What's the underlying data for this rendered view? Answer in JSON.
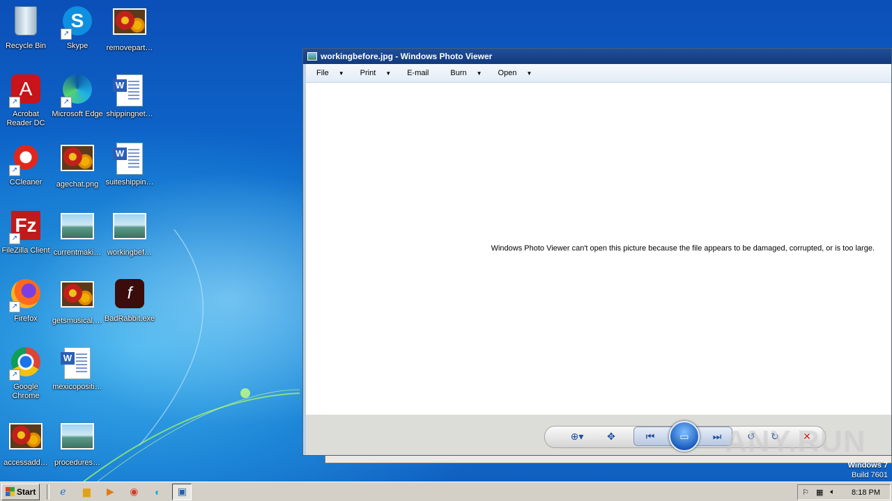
{
  "desktop": {
    "icons": [
      {
        "label": "Recycle Bin",
        "icon": "recycle-bin-icon",
        "shortcut": false
      },
      {
        "label": "Skype",
        "icon": "skype-icon",
        "shortcut": true
      },
      {
        "label": "removepart…",
        "icon": "image-file-icon",
        "shortcut": false
      },
      {
        "label": "Acrobat Reader DC",
        "icon": "acrobat-icon",
        "shortcut": true
      },
      {
        "label": "Microsoft Edge",
        "icon": "edge-icon",
        "shortcut": true
      },
      {
        "label": "shippingnet…",
        "icon": "word-doc-icon",
        "shortcut": false
      },
      {
        "label": "CCleaner",
        "icon": "ccleaner-icon",
        "shortcut": true
      },
      {
        "label": "agechat.png",
        "icon": "image-file-icon",
        "shortcut": false
      },
      {
        "label": "suiteshippin…",
        "icon": "word-doc-icon",
        "shortcut": false
      },
      {
        "label": "FileZilla Client",
        "icon": "filezilla-icon",
        "shortcut": true
      },
      {
        "label": "currentmaki…",
        "icon": "landscape-file-icon",
        "shortcut": false
      },
      {
        "label": "workingbef…",
        "icon": "landscape-file-icon",
        "shortcut": false
      },
      {
        "label": "Firefox",
        "icon": "firefox-icon",
        "shortcut": true
      },
      {
        "label": "getsmusical.…",
        "icon": "image-file-icon",
        "shortcut": false
      },
      {
        "label": "BadRabbit.exe",
        "icon": "flash-installer-icon",
        "shortcut": false
      },
      {
        "label": "Google Chrome",
        "icon": "chrome-icon",
        "shortcut": true
      },
      {
        "label": "mexicopositi…",
        "icon": "word-doc-icon",
        "shortcut": false
      },
      {
        "label": "accessadd…",
        "icon": "image-file-icon",
        "shortcut": false
      },
      {
        "label": "procedures…",
        "icon": "landscape-file-icon",
        "shortcut": false
      }
    ]
  },
  "window": {
    "title": "workingbefore.jpg - Windows Photo Viewer",
    "menu": [
      {
        "label": "File",
        "has_arrow": true
      },
      {
        "label": "Print",
        "has_arrow": true
      },
      {
        "label": "E-mail",
        "has_arrow": false
      },
      {
        "label": "Burn",
        "has_arrow": true
      },
      {
        "label": "Open",
        "has_arrow": true
      }
    ],
    "error_message": "Windows Photo Viewer can't open this picture because the file appears to be damaged, corrupted, or is too large.",
    "controls": [
      "zoom-icon",
      "actual-size-icon",
      "previous-icon",
      "slideshow-icon",
      "next-icon",
      "rotate-left-icon",
      "rotate-right-icon",
      "delete-icon"
    ]
  },
  "watermark": "ANY.RUN",
  "os_version": {
    "line1": "Windows 7",
    "line2": "Build 7601"
  },
  "taskbar": {
    "start_label": "Start",
    "apps": [
      "ie-icon",
      "explorer-icon",
      "media-player-icon",
      "chrome-icon",
      "edge-icon",
      "photo-viewer-icon"
    ],
    "clock": "8:18 PM"
  }
}
